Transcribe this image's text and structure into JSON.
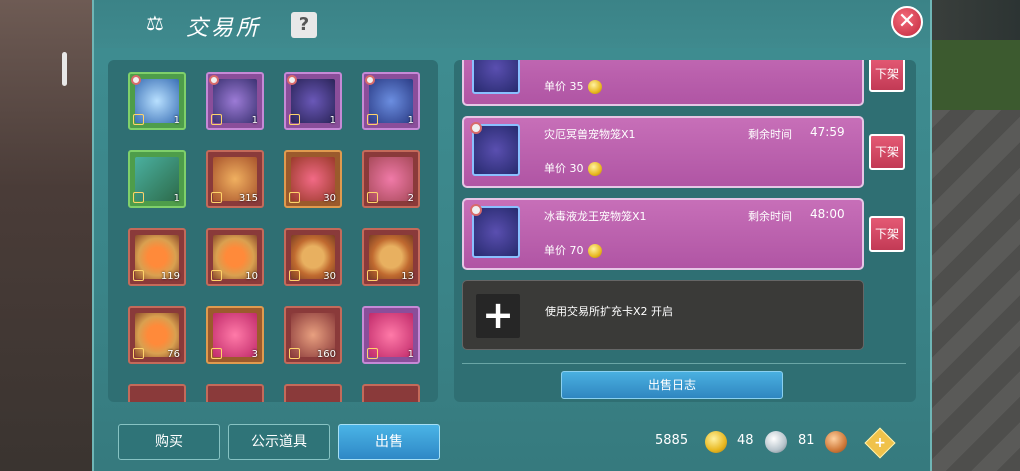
{
  "window": {
    "title": "交易所",
    "help_label": "?",
    "close_label": "✕"
  },
  "inventory": {
    "items": [
      {
        "name": "pet-cage-ice-beast",
        "style": "g",
        "art": "mon1",
        "count": "1"
      },
      {
        "name": "pet-cage-purple-beast",
        "style": "p",
        "art": "mon2",
        "count": "1"
      },
      {
        "name": "pet-cage-dark-beast",
        "style": "p",
        "art": "mon3",
        "count": "1"
      },
      {
        "name": "pet-cage-blue-dragon",
        "style": "p",
        "art": "mon4",
        "count": "1"
      },
      {
        "name": "magic-wand",
        "style": "g",
        "art": "wand",
        "count": "1"
      },
      {
        "name": "golden-shirt",
        "style": "r",
        "art": "shirt",
        "count": "315"
      },
      {
        "name": "flower-charm",
        "style": "o",
        "art": "flower",
        "count": "30"
      },
      {
        "name": "ticket",
        "style": "r",
        "art": "ticket",
        "count": "2"
      },
      {
        "name": "food-dish-1",
        "style": "r",
        "art": "dish",
        "count": "119"
      },
      {
        "name": "food-dish-2",
        "style": "r",
        "art": "dish",
        "count": "10"
      },
      {
        "name": "soup-bowl",
        "style": "r",
        "art": "soup",
        "count": "30"
      },
      {
        "name": "soup-plate",
        "style": "r",
        "art": "soup",
        "count": "13"
      },
      {
        "name": "food-dish-3",
        "style": "r",
        "art": "dish",
        "count": "76"
      },
      {
        "name": "heart-badge",
        "style": "o",
        "art": "badge",
        "count": "3"
      },
      {
        "name": "fan-item",
        "style": "r",
        "art": "fan",
        "count": "160"
      },
      {
        "name": "pink-badge",
        "style": "p",
        "art": "badge",
        "count": "1"
      }
    ]
  },
  "listings": [
    {
      "name": "",
      "time_label": "",
      "time": "",
      "price_label": "单价",
      "price": "35",
      "delist": "下架"
    },
    {
      "name": "灾厄冥兽宠物笼X1",
      "time_label": "剩余时间",
      "time": "47:59",
      "price_label": "单价",
      "price": "30",
      "delist": "下架"
    },
    {
      "name": "冰毒液龙王宠物笼X1",
      "time_label": "剩余时间",
      "time": "48:00",
      "price_label": "单价",
      "price": "70",
      "delist": "下架"
    }
  ],
  "expand_slot": {
    "text": "使用交易所扩充卡X2 开启",
    "plus": "+"
  },
  "sale_log_button": "出售日志",
  "tabs": {
    "buy": "购买",
    "public": "公示道具",
    "sell": "出售"
  },
  "currency": {
    "gold": "5885",
    "silver": "48",
    "bronze": "81",
    "add": "+"
  }
}
